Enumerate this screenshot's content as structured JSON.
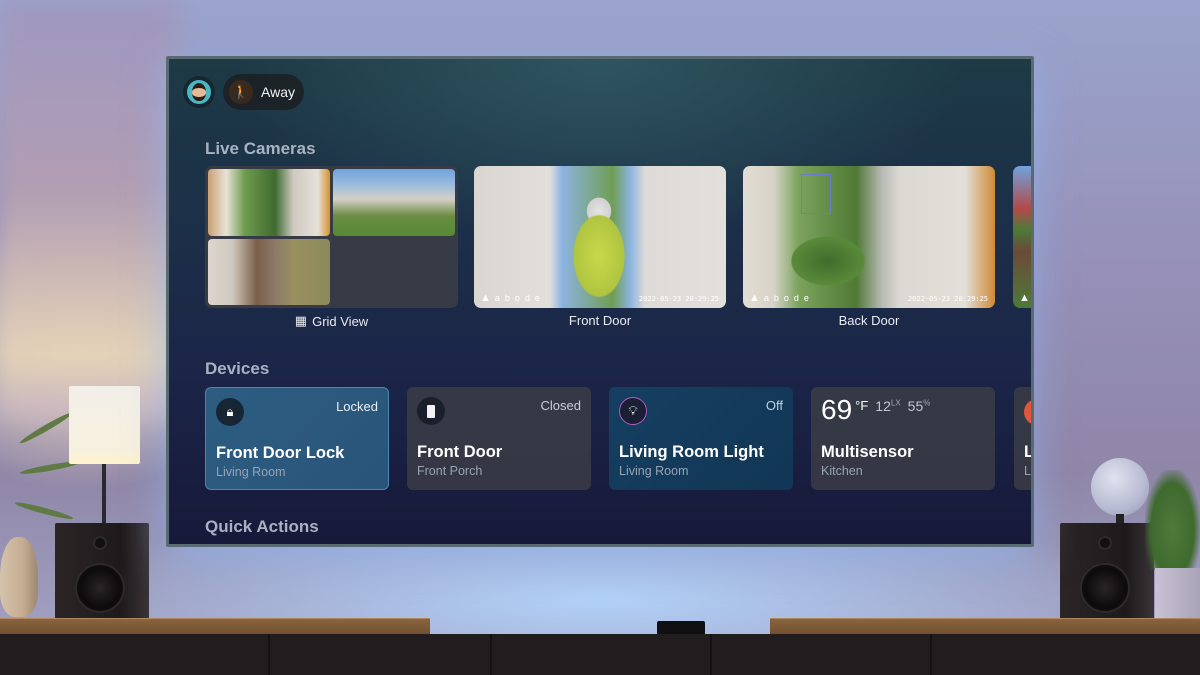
{
  "header": {
    "profile_avatar": "user-avatar",
    "mode": {
      "label": "Away",
      "icon": "away-mode-icon",
      "color": "#f0a040"
    }
  },
  "sections": {
    "live_cameras": "Live Cameras",
    "devices": "Devices",
    "quick_actions": "Quick Actions"
  },
  "cameras": [
    {
      "label": "Grid View",
      "icon": "grid-view-icon",
      "type": "grid"
    },
    {
      "label": "Front Door",
      "brand": "abode",
      "timestamp": "2022-05-23 20:29:25"
    },
    {
      "label": "Back Door",
      "brand": "abode",
      "timestamp": "2022-05-23 20:29:25"
    },
    {
      "label": "",
      "brand": "",
      "timestamp": ""
    }
  ],
  "devices": [
    {
      "name": "Front Door Lock",
      "room": "Living Room",
      "status": "Locked",
      "icon": "lock-icon"
    },
    {
      "name": "Front Door",
      "room": "Front Porch",
      "status": "Closed",
      "icon": "door-icon"
    },
    {
      "name": "Living Room Light",
      "room": "Living Room",
      "status": "Off",
      "icon": "light-bulb-icon"
    },
    {
      "name": "Multisensor",
      "room": "Kitchen",
      "temperature": "69",
      "temp_unit": "°F",
      "lux": "12",
      "lux_unit": "LX",
      "humidity": "55",
      "humidity_unit": "%"
    },
    {
      "name": "L",
      "room": "L"
    }
  ],
  "colors": {
    "accent_blue": "#2d5d82",
    "screen_bg": "#1b2548"
  }
}
